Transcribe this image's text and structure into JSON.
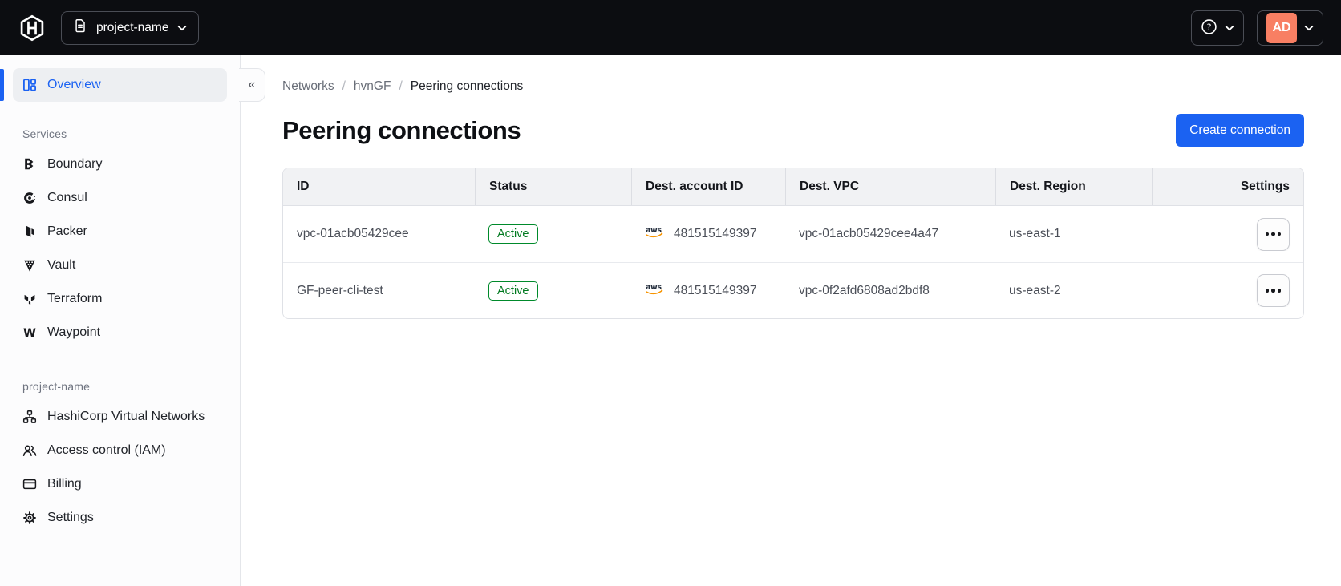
{
  "topbar": {
    "project_name": "project-name",
    "help_glyph": "?",
    "avatar_initials": "AD"
  },
  "sidebar": {
    "collapse_glyph": "«",
    "overview": "Overview",
    "sections": [
      {
        "label": "Services",
        "items": [
          "Boundary",
          "Consul",
          "Packer",
          "Vault",
          "Terraform",
          "Waypoint"
        ]
      },
      {
        "label": "project-name",
        "items": [
          "HashiCorp Virtual Networks",
          "Access control (IAM)",
          "Billing",
          "Settings"
        ]
      }
    ]
  },
  "breadcrumb": {
    "items": [
      "Networks",
      "hvnGF",
      "Peering connections"
    ],
    "separator": "/"
  },
  "page": {
    "title": "Peering connections",
    "create_button": "Create connection"
  },
  "icons": {
    "aws_label": "aws"
  },
  "table": {
    "columns": [
      "ID",
      "Status",
      "Dest. account ID",
      "Dest. VPC",
      "Dest. Region",
      "Settings"
    ],
    "rows": [
      {
        "id": "vpc-01acb05429cee",
        "status": "Active",
        "account_id": "481515149397",
        "vpc": "vpc-01acb05429cee4a47",
        "region": "us-east-1"
      },
      {
        "id": "GF-peer-cli-test",
        "status": "Active",
        "account_id": "481515149397",
        "vpc": "vpc-0f2afd6808ad2bdf8",
        "region": "us-east-2"
      }
    ]
  },
  "colors": {
    "accent_blue": "#1b62f2",
    "badge_green_text": "#00791f",
    "badge_green_border": "#008a2b",
    "avatar_orange": "#f87f63",
    "aws_orange": "#f79400",
    "topbar_black": "#0c0d11"
  }
}
